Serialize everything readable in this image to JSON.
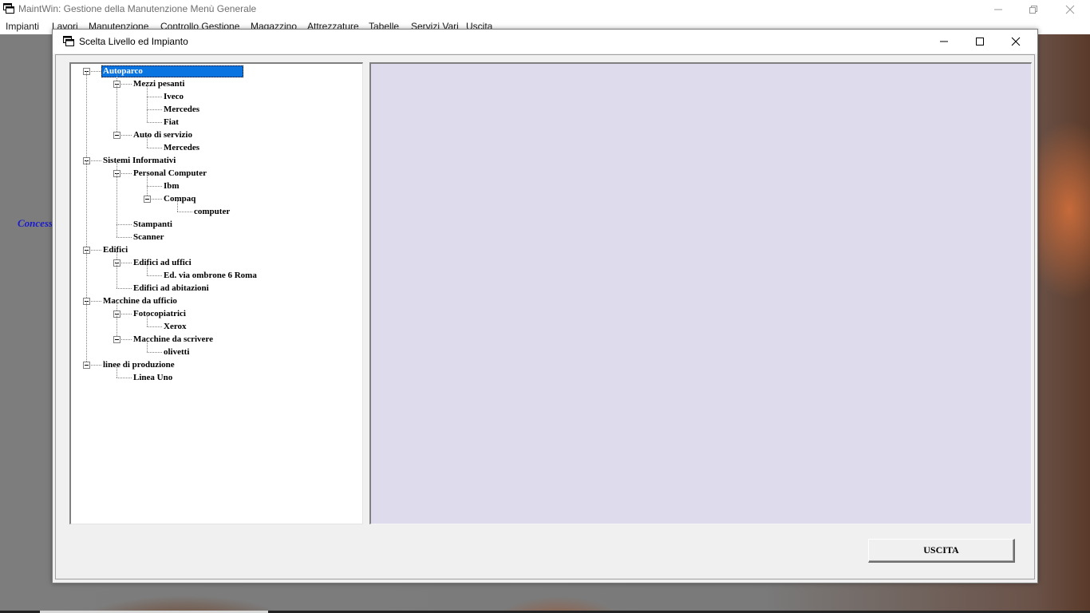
{
  "app": {
    "title": "MaintWin: Gestione della Manutenzione   Menù Generale",
    "menu": [
      "Impianti",
      "Lavori",
      "Manutenzione",
      "Controllo Gestione",
      "Magazzino",
      "Attrezzature",
      "Tabelle",
      "Servizi Vari",
      "Uscita"
    ],
    "background_label": "Concess"
  },
  "dialog": {
    "title": "Scelta Livello ed Impianto",
    "tree": [
      {
        "label": "Autoparco",
        "level": 0,
        "selected": true
      },
      {
        "label": "Mezzi pesanti",
        "level": 1
      },
      {
        "label": "Iveco",
        "level": 2
      },
      {
        "label": "Mercedes",
        "level": 2
      },
      {
        "label": "Fiat",
        "level": 2
      },
      {
        "label": "Auto di servizio",
        "level": 1
      },
      {
        "label": "Mercedes",
        "level": 2
      },
      {
        "label": "Sistemi Informativi",
        "level": 0
      },
      {
        "label": "Personal Computer",
        "level": 1
      },
      {
        "label": "Ibm",
        "level": 2
      },
      {
        "label": "Compaq",
        "level": 2
      },
      {
        "label": "computer",
        "level": 3
      },
      {
        "label": "Stampanti",
        "level": 1
      },
      {
        "label": "Scanner",
        "level": 1
      },
      {
        "label": "Edifici",
        "level": 0
      },
      {
        "label": "Edifici ad uffici",
        "level": 1
      },
      {
        "label": "Ed. via ombrone 6 Roma",
        "level": 2
      },
      {
        "label": "Edifici ad abitazioni",
        "level": 1
      },
      {
        "label": "Macchine da ufficio",
        "level": 0
      },
      {
        "label": "Fotocopiatrici",
        "level": 1
      },
      {
        "label": "Xerox",
        "level": 2
      },
      {
        "label": "Macchine da scrivere",
        "level": 1
      },
      {
        "label": "olivetti",
        "level": 2
      },
      {
        "label": "linee di produzione",
        "level": 0
      },
      {
        "label": "Linea Uno",
        "level": 1
      }
    ],
    "exit_label": "USCITA"
  },
  "colors": {
    "selection": "#0a74e0",
    "detail_panel": "#dedcec",
    "background_link": "#1a1ad0"
  }
}
